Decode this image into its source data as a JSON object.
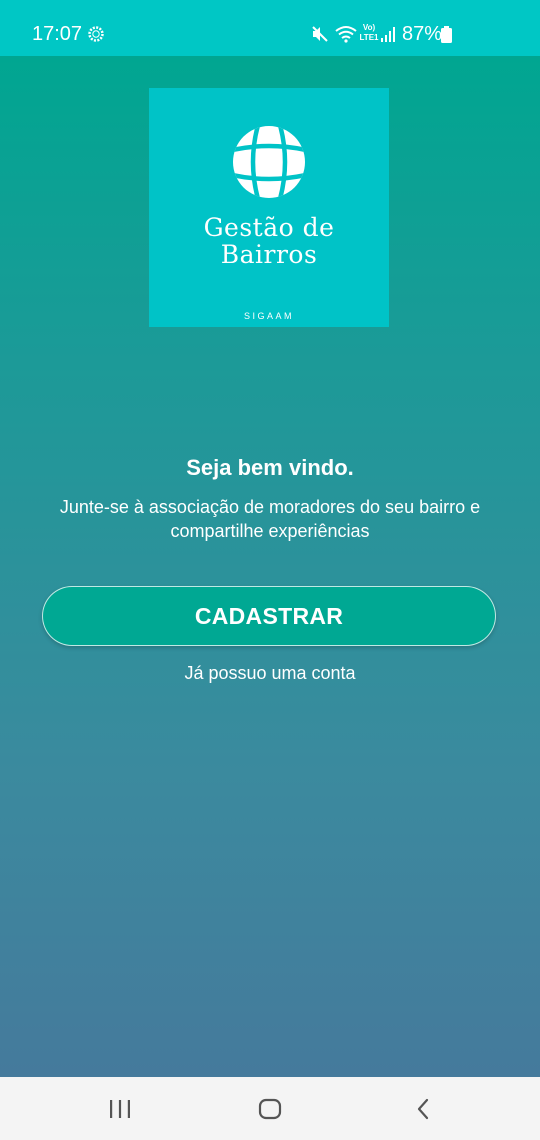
{
  "status_bar": {
    "time": "17:07",
    "battery": "87%",
    "network_label_top": "Vo)",
    "network_label_bottom": "LTE1",
    "icons": [
      "settings-gear-icon",
      "mute-icon",
      "wifi-icon",
      "signal-icon",
      "battery-icon"
    ]
  },
  "logo": {
    "title_line1": "Gestão de",
    "title_line2": "Bairros",
    "subtitle": "SIGAAM",
    "icon": "globe-icon"
  },
  "welcome": {
    "title": "Seja bem vindo.",
    "text_line1": "Junte-se à associação de moradores do seu bairro e",
    "text_line2": "compartilhe experiências"
  },
  "actions": {
    "signup_label": "CADASTRAR",
    "login_label": "Já possuo uma conta"
  },
  "nav_bar": {
    "icons": [
      "recent-apps-icon",
      "home-icon",
      "back-icon"
    ]
  },
  "colors": {
    "status_bar": "#00c7c5",
    "gradient_top": "#00a691",
    "gradient_bottom": "#457a9c",
    "logo_bg": "#00c3c7",
    "button_bg": "#00a893",
    "nav_bar": "#f4f4f4"
  }
}
